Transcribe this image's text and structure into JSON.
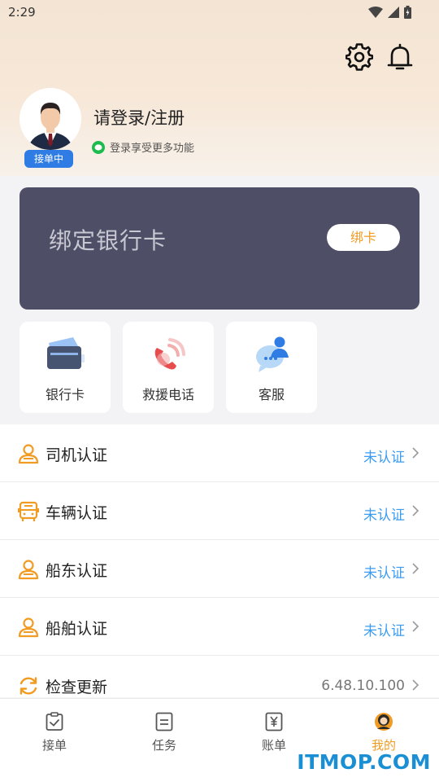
{
  "status_bar": {
    "time": "2:29"
  },
  "profile": {
    "badge": "接单中",
    "login_title": "请登录/注册",
    "login_subtitle": "登录享受更多功能"
  },
  "bank_card": {
    "title": "绑定银行卡",
    "bind_label": "绑卡"
  },
  "quick_actions": [
    {
      "label": "银行卡",
      "icon": "bank-card-icon"
    },
    {
      "label": "救援电话",
      "icon": "rescue-phone-icon"
    },
    {
      "label": "客服",
      "icon": "customer-service-icon"
    }
  ],
  "menu": [
    {
      "label": "司机认证",
      "status": "未认证",
      "icon": "driver-icon"
    },
    {
      "label": "车辆认证",
      "status": "未认证",
      "icon": "vehicle-icon"
    },
    {
      "label": "船东认证",
      "status": "未认证",
      "icon": "shipowner-icon"
    },
    {
      "label": "船舶认证",
      "status": "未认证",
      "icon": "ship-icon"
    },
    {
      "label": "检查更新",
      "status": "6.48.10.100",
      "icon": "refresh-icon"
    }
  ],
  "tabs": [
    {
      "label": "接单",
      "icon": "clipboard-check-icon"
    },
    {
      "label": "任务",
      "icon": "task-list-icon"
    },
    {
      "label": "账单",
      "icon": "bill-yuan-icon"
    },
    {
      "label": "我的",
      "icon": "profile-icon",
      "active": true
    }
  ],
  "colors": {
    "accent": "#f29b22",
    "link": "#3b9cf1",
    "card": "#4e4f67",
    "badge": "#2f7de4"
  },
  "watermark": "ITMOP.COM"
}
